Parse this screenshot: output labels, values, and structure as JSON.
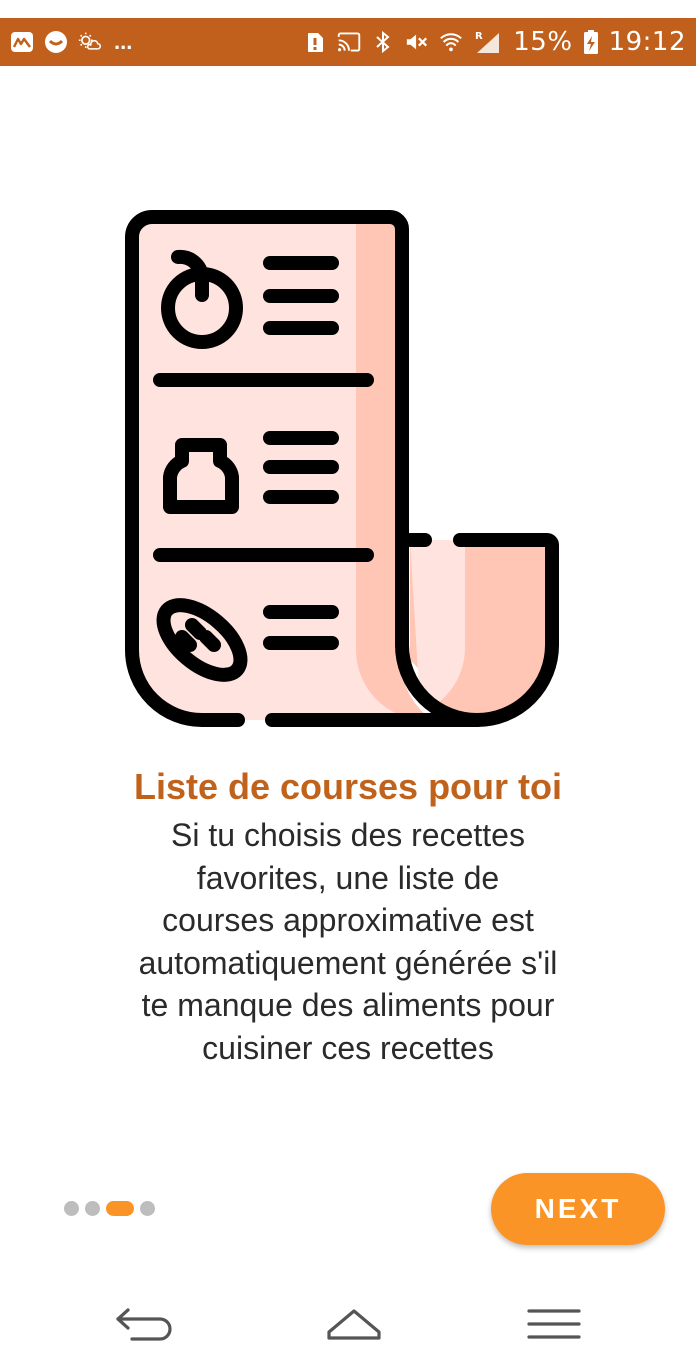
{
  "status_bar": {
    "background": "#c0601c",
    "battery_text": "15%",
    "time": "19:12",
    "overflow_text": "...",
    "roaming_label": "R",
    "left_icons": [
      "app-notification-icon",
      "chat-bubble-icon",
      "weather-icon"
    ],
    "right_icons": [
      "sim-alert-icon",
      "cast-icon",
      "bluetooth-icon",
      "mute-icon",
      "wifi-icon",
      "signal-icon",
      "battery-charging-icon"
    ]
  },
  "illustration": {
    "icon": "shopping-list-receipt-icon",
    "outline_color": "#000000",
    "paper_color": "#ffe3de",
    "shadow_color": "#ffc6b5"
  },
  "content": {
    "title": "Liste de courses pour toi",
    "title_color": "#c0621c",
    "description_lines": [
      "Si tu choisis des recettes",
      "favorites, une liste de",
      "courses approximative est",
      "automatiquement générée s'il",
      "te manque des aliments pour",
      "cuisiner ces recettes"
    ]
  },
  "pager": {
    "total_pages": 4,
    "current_page": 3,
    "active_color": "#fb9426",
    "inactive_color": "#bdbdbd"
  },
  "next_button": {
    "label": "NEXT",
    "color": "#fb9426"
  },
  "nav_bar": {
    "icons": [
      "back-icon",
      "home-icon",
      "menu-icon"
    ],
    "icon_color": "#555555"
  }
}
